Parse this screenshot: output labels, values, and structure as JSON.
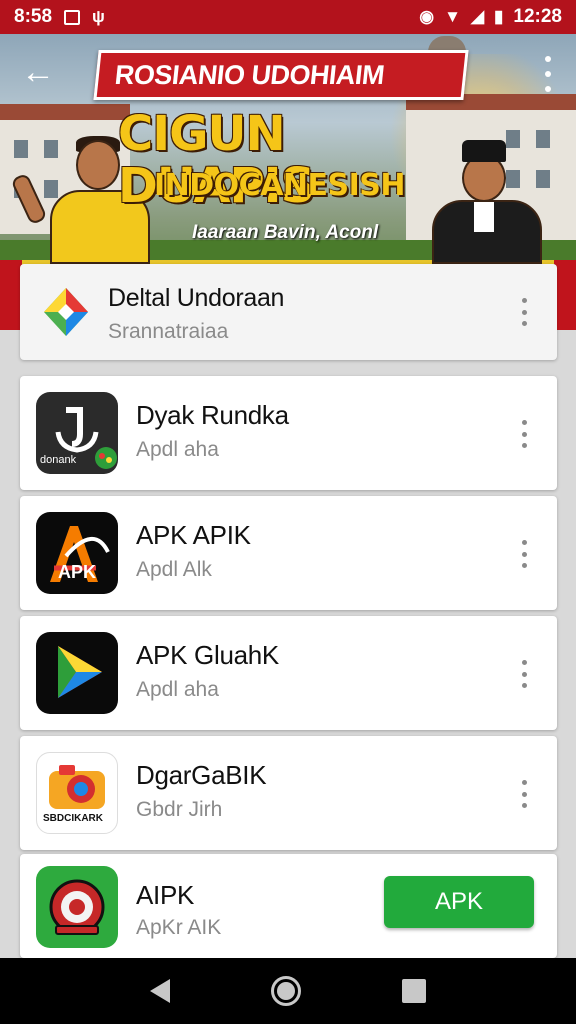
{
  "status_bar": {
    "time_left": "8:58",
    "clock": "12:28",
    "icons_left": [
      "image-icon",
      "usb-icon"
    ],
    "icons_right": [
      "alarm-icon",
      "wifi-icon",
      "signal-icon",
      "battery-icon"
    ]
  },
  "banner": {
    "ribbon_text": "ROSIANIO UDOHIAIM",
    "title": "CIGUN DUAPIS",
    "subtitle": "INDOCANESISH",
    "tagline": "Iaaraan Bavin, Aconl"
  },
  "apps": [
    {
      "title": "Deltal Undoraan",
      "subtitle": "Srannatraiaa",
      "icon": "diamond-logo-icon",
      "action": "menu"
    },
    {
      "title": "Dyak Rundka",
      "subtitle": "Apdl aha",
      "icon_label": "donank",
      "icon": "anchor-app-icon",
      "action": "menu"
    },
    {
      "title": "APK APIK",
      "subtitle": "Apdl Alk",
      "icon_label": "APK",
      "icon": "apk-app-icon",
      "action": "menu"
    },
    {
      "title": "APK GluahK",
      "subtitle": "Apdl aha",
      "icon": "play-app-icon",
      "action": "menu"
    },
    {
      "title": "DgarGaBIK",
      "subtitle": "Gbdr Jirh",
      "icon_label": "SBDCIKARK",
      "icon": "camera-app-icon",
      "action": "menu"
    },
    {
      "title": "AIPK",
      "subtitle": "ApKr AIK",
      "icon": "emblem-app-icon",
      "action": "install",
      "button_label": "APK"
    }
  ],
  "colors": {
    "status_bar": "#b3121c",
    "install_button": "#22aa3c",
    "banner_title": "#f5c518"
  },
  "nav_bar": {
    "buttons": [
      "back-icon",
      "home-icon",
      "recents-icon"
    ]
  }
}
